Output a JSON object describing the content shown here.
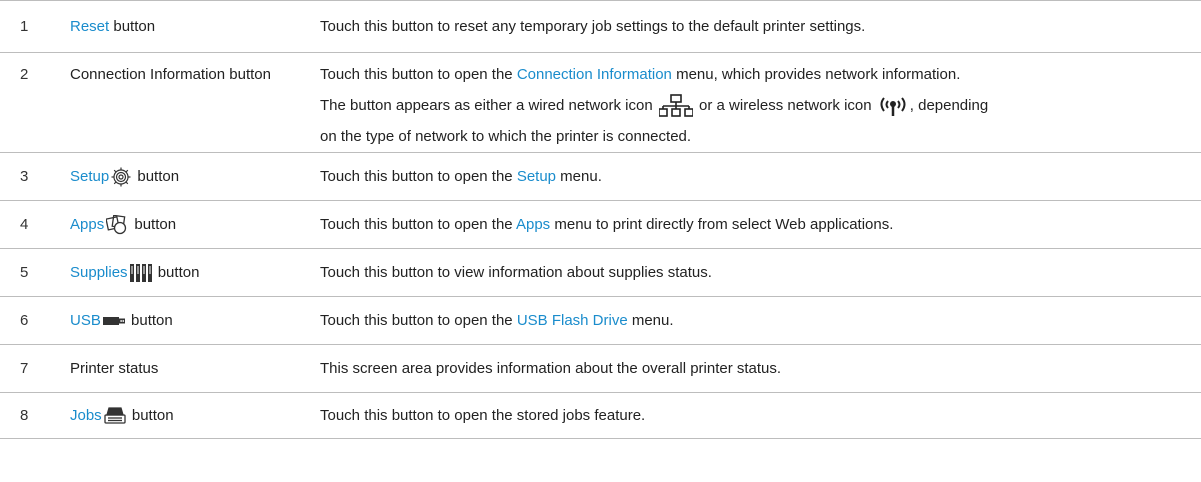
{
  "rows": [
    {
      "num": "1",
      "item_link": "Reset",
      "item_rest": " button",
      "desc_a": "Touch this button to reset any temporary job settings to the default printer settings."
    },
    {
      "num": "2",
      "item_plain": "Connection Information button",
      "desc_a": "Touch this button to open the ",
      "desc_link": "Connection Information",
      "desc_b": " menu, which provides network information.",
      "desc_c": "The button appears as either a wired network icon ",
      "desc_d": " or a wireless network icon ",
      "desc_e": ", depending",
      "desc_f": "on the type of network to which the printer is connected.",
      "icon_wired": "wired-network-icon",
      "icon_wireless": "wireless-network-icon"
    },
    {
      "num": "3",
      "item_link": "Setup",
      "item_rest": " button",
      "icon": "gear-icon",
      "desc_a": "Touch this button to open the ",
      "desc_link": "Setup",
      "desc_b": " menu."
    },
    {
      "num": "4",
      "item_link": "Apps",
      "item_rest": " button",
      "icon": "apps-icon",
      "desc_a": "Touch this button to open the ",
      "desc_link": "Apps",
      "desc_b": " menu to print directly from select Web applications."
    },
    {
      "num": "5",
      "item_link": "Supplies",
      "item_rest": " button",
      "icon": "supplies-icon",
      "desc_a": "Touch this button to view information about supplies status."
    },
    {
      "num": "6",
      "item_link": "USB",
      "item_rest": " button",
      "icon": "usb-icon",
      "desc_a": "Touch this button to open the ",
      "desc_link": "USB Flash Drive",
      "desc_b": " menu."
    },
    {
      "num": "7",
      "item_plain": "Printer status",
      "desc_a": "This screen area provides information about the overall printer status."
    },
    {
      "num": "8",
      "item_link": "Jobs",
      "item_rest": " button",
      "icon": "jobs-icon",
      "desc_a": "Touch this button to open the stored jobs feature."
    }
  ],
  "colors": {
    "link": "#1a8ccc",
    "rule": "#bdbdbd",
    "text": "#222222"
  }
}
